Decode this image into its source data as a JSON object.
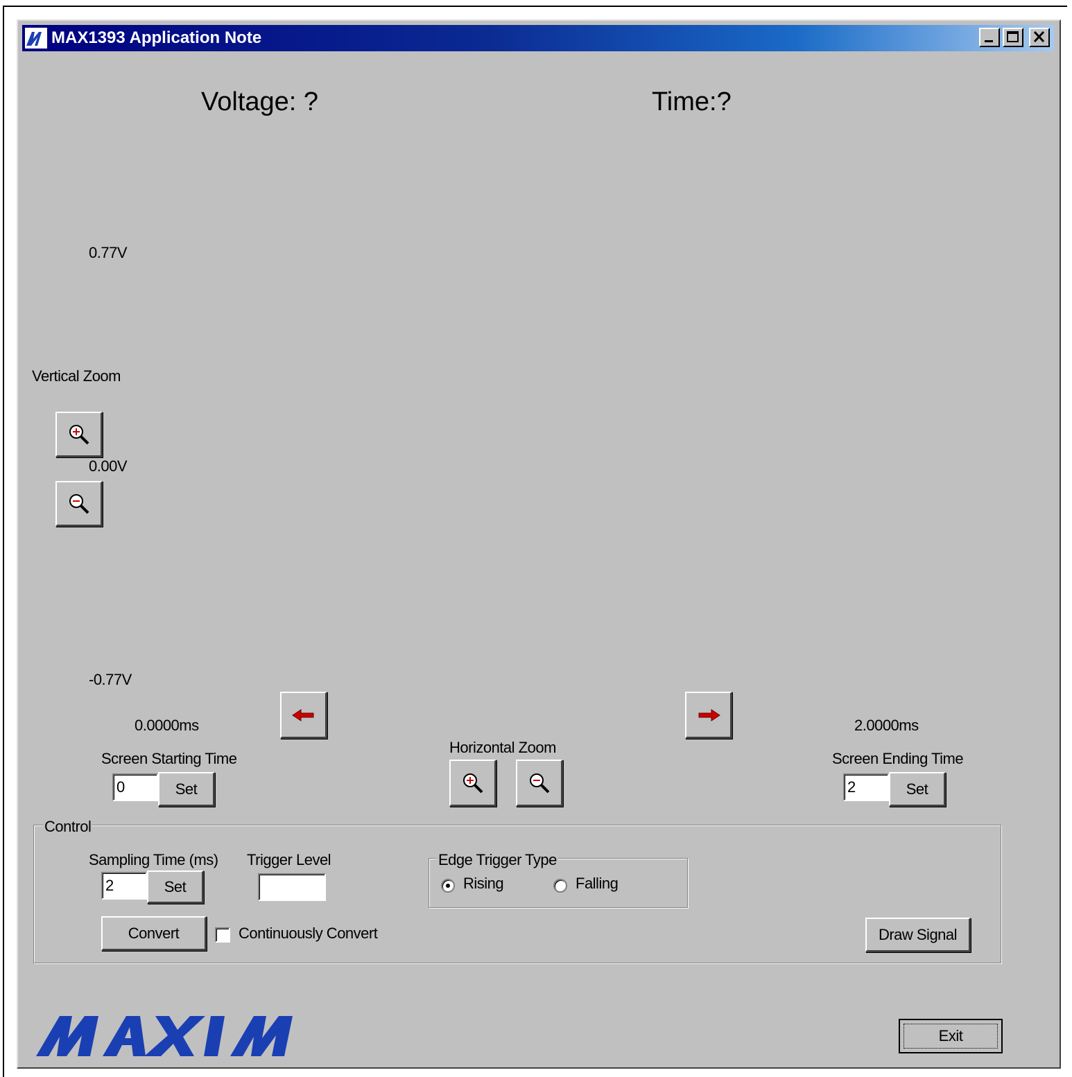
{
  "window": {
    "title": "MAX1393 Application Note",
    "title_bar_color": "#000080"
  },
  "readouts": {
    "voltage": "Voltage: ?",
    "time": "Time:?"
  },
  "voltage_axis": {
    "top": "0.77V",
    "middle": "0.00V",
    "bottom": "-0.77V"
  },
  "vertical_zoom": {
    "label": "Vertical Zoom",
    "zoom_in_icon": "zoom-in-icon",
    "zoom_out_icon": "zoom-out-icon"
  },
  "time_axis": {
    "start": "0.0000ms",
    "end": "2.0000ms",
    "scroll_left_icon": "left-arrow-icon",
    "scroll_right_icon": "right-arrow-icon"
  },
  "horizontal_zoom": {
    "label": "Horizontal Zoom"
  },
  "screen_start": {
    "label": "Screen Starting Time",
    "value": "0",
    "button": "Set"
  },
  "screen_end": {
    "label": "Screen Ending Time",
    "value": "2",
    "button": "Set"
  },
  "control": {
    "title": "Control",
    "sampling_label": "Sampling Time (ms)",
    "sampling_value": "2",
    "sampling_button": "Set",
    "trigger_label": "Trigger Level",
    "trigger_value": "",
    "edge_title": "Edge Trigger Type",
    "edge_options": [
      "Rising",
      "Falling"
    ],
    "edge_selected": "Rising",
    "convert_button": "Convert",
    "continuous_label": "Continuously Convert",
    "continuous_checked": false,
    "draw_button": "Draw Signal"
  },
  "footer": {
    "logo_text": "MAXIM",
    "logo_color": "#1a3fb3",
    "exit_button": "Exit"
  }
}
